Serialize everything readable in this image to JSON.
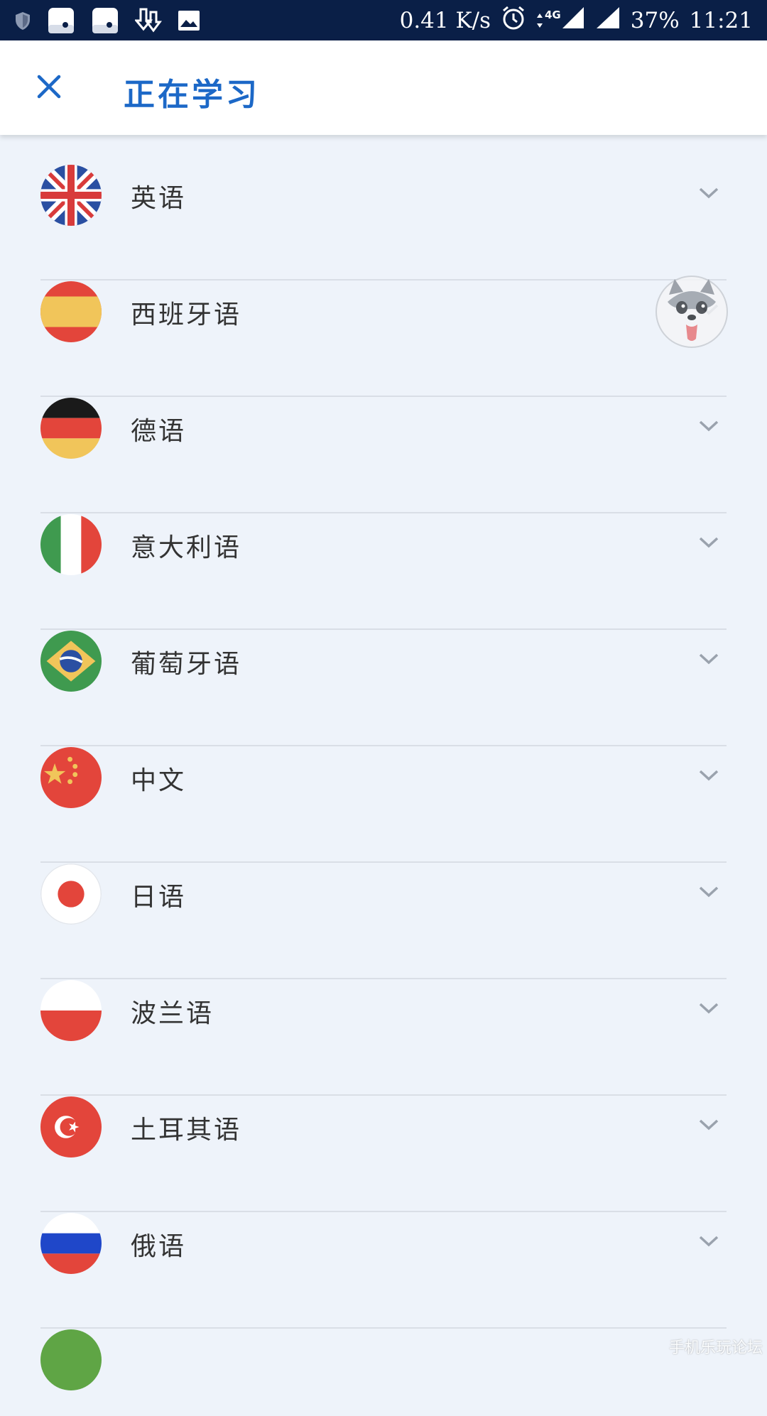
{
  "status_bar": {
    "speed": "0.41 K/s",
    "network": "4G",
    "battery": "37%",
    "time": "11:21",
    "icons": [
      "shield-icon",
      "notification-app-icon",
      "notification-app-icon",
      "download-icon",
      "image-icon",
      "alarm-icon",
      "data-arrows-icon",
      "signal-icon",
      "signal-icon"
    ]
  },
  "header": {
    "close_icon": "close-icon",
    "title": "正在学习",
    "accent_color": "#1c68c7"
  },
  "languages": [
    {
      "label": "英语",
      "flag": "united-kingdom-flag-icon"
    },
    {
      "label": "西班牙语",
      "flag": "spain-flag-icon"
    },
    {
      "label": "德语",
      "flag": "germany-flag-icon"
    },
    {
      "label": "意大利语",
      "flag": "italy-flag-icon"
    },
    {
      "label": "葡萄牙语",
      "flag": "brazil-flag-icon"
    },
    {
      "label": "中文",
      "flag": "china-flag-icon"
    },
    {
      "label": "日语",
      "flag": "japan-flag-icon"
    },
    {
      "label": "波兰语",
      "flag": "poland-flag-icon"
    },
    {
      "label": "土耳其语",
      "flag": "turkey-flag-icon"
    },
    {
      "label": "俄语",
      "flag": "russia-flag-icon"
    },
    {
      "label": "",
      "flag": "green-flag-icon"
    }
  ],
  "row_chevron_icon": "chevron-down-icon",
  "floating_widget": "husky-mascot-icon",
  "watermark": "手机乐玩论坛"
}
